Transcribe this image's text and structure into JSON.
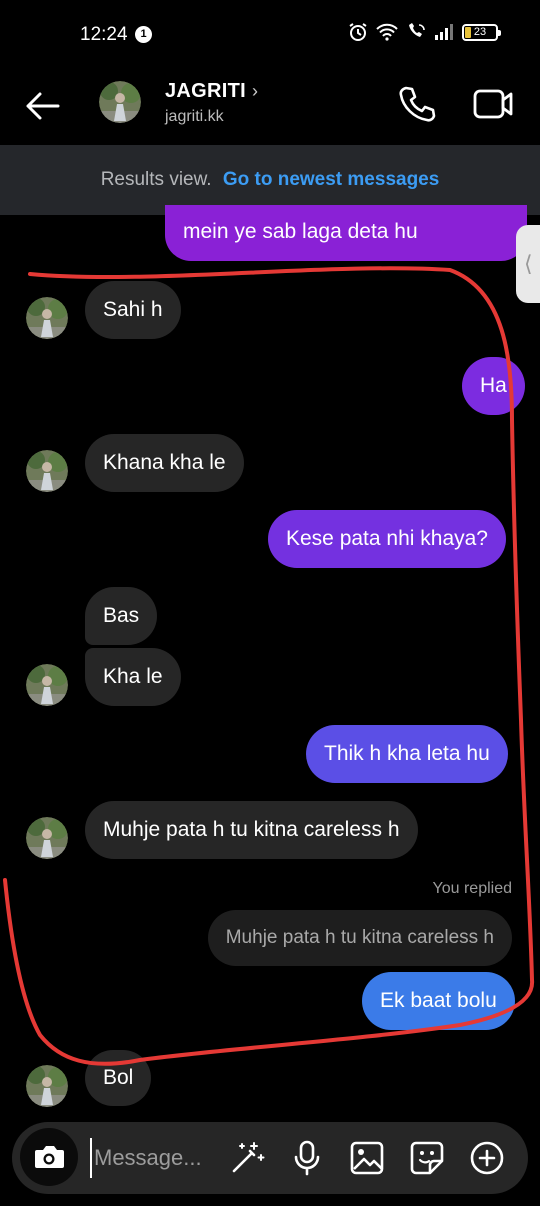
{
  "status_bar": {
    "time": "12:24",
    "notification_count": "1",
    "battery": "23"
  },
  "header": {
    "name": "JAGRITI",
    "username": "jagriti.kk",
    "chevron": "›"
  },
  "banner": {
    "label": "Results view.",
    "link": "Go to newest messages"
  },
  "messages": [
    {
      "from": "me",
      "text": "mein ye sab laga deta hu"
    },
    {
      "from": "them",
      "text": "Sahi h"
    },
    {
      "from": "me",
      "text": "Ha"
    },
    {
      "from": "them",
      "text": "Khana kha le"
    },
    {
      "from": "me",
      "text": "Kese pata nhi khaya?"
    },
    {
      "from": "them",
      "text": "Bas"
    },
    {
      "from": "them",
      "text": "Kha le"
    },
    {
      "from": "me",
      "text": "Thik h kha leta hu"
    },
    {
      "from": "them",
      "text": "Muhje pata h tu kitna careless h"
    },
    {
      "from": "me",
      "text": "Ek baat bolu"
    },
    {
      "from": "them",
      "text": "Bol"
    }
  ],
  "reply": {
    "label": "You replied",
    "quoted": "Muhje pata h tu kitna careless h"
  },
  "composer": {
    "placeholder": "Message..."
  },
  "colors": {
    "sent_purple": "#8a21d6",
    "sent_violet": "#7c35e0",
    "sent_indigo": "#5b4fe6",
    "sent_blue": "#3b7be8",
    "received": "#262626",
    "link": "#3c9cf3",
    "annotation_red": "#e53935"
  },
  "icons": [
    "back-arrow-icon",
    "phone-icon",
    "video-camera-icon",
    "camera-icon",
    "magic-wand-icon",
    "microphone-icon",
    "gallery-icon",
    "sticker-icon",
    "plus-icon"
  ]
}
